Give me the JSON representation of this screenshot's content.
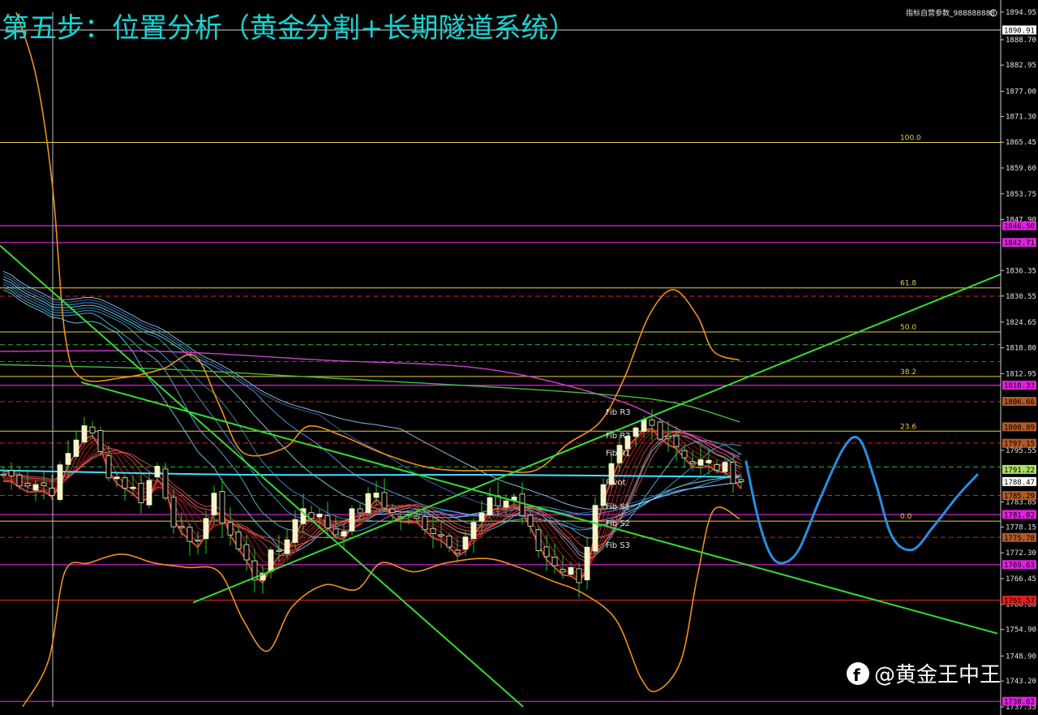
{
  "chart_data": {
    "type": "candlestick",
    "title": "第五步：位置分析（黄金分割+长期隧道系统）",
    "indicator_label": "指标自营参数_988888888",
    "watermark": "@黄金王中王",
    "ylim": [
      1737.35,
      1894.95
    ],
    "y_ticks": [
      "1894.95",
      "1888.70",
      "1882.95",
      "1877.00",
      "1871.30",
      "1865.45",
      "1859.60",
      "1853.75",
      "1847.90",
      "1836.35",
      "1830.55",
      "1824.65",
      "1818.80",
      "1812.95",
      "1795.55",
      "1783.85",
      "1778.15",
      "1772.30",
      "1766.45",
      "1760.60",
      "1754.90",
      "1748.90",
      "1743.20",
      "1737.35"
    ],
    "price_badges": [
      {
        "value": 1890.91,
        "text": "1890.91",
        "bg": "#ffffff",
        "fg": "#000000"
      },
      {
        "value": 1846.5,
        "text": "1846.50",
        "bg": "#e020e0",
        "fg": "#000000"
      },
      {
        "value": 1842.71,
        "text": "1842.71",
        "bg": "#e020e0",
        "fg": "#000000"
      },
      {
        "value": 1810.33,
        "text": "1810.33",
        "bg": "#e020e0",
        "fg": "#000000"
      },
      {
        "value": 1806.66,
        "text": "1806.66",
        "bg": "#b05a28",
        "fg": "#000000"
      },
      {
        "value": 1800.89,
        "text": "1800.89",
        "bg": "#b05a28",
        "fg": "#000000"
      },
      {
        "value": 1797.15,
        "text": "1797.15",
        "bg": "#b05a28",
        "fg": "#000000"
      },
      {
        "value": 1791.22,
        "text": "1791.22",
        "bg": "#a8e060",
        "fg": "#000000"
      },
      {
        "value": 1788.47,
        "text": "1788.47",
        "bg": "#ffffff",
        "fg": "#000000"
      },
      {
        "value": 1785.29,
        "text": "1785.29",
        "bg": "#b05a28",
        "fg": "#000000"
      },
      {
        "value": 1781.02,
        "text": "1781.02",
        "bg": "#e020e0",
        "fg": "#000000"
      },
      {
        "value": 1775.78,
        "text": "1775.78",
        "bg": "#b05a28",
        "fg": "#000000"
      },
      {
        "value": 1769.63,
        "text": "1769.63",
        "bg": "#e020e0",
        "fg": "#000000"
      },
      {
        "value": 1761.57,
        "text": "1761.57",
        "bg": "#e02020",
        "fg": "#000000"
      },
      {
        "value": 1738.62,
        "text": "1738.62",
        "bg": "#e020e0",
        "fg": "#000000"
      }
    ],
    "fib_levels": [
      {
        "label": "100.0",
        "value": 1865.4
      },
      {
        "label": "61.8",
        "value": 1832.4
      },
      {
        "label": "50.0",
        "value": 1822.4
      },
      {
        "label": "38.2",
        "value": 1812.3
      },
      {
        "label": "23.6",
        "value": 1799.9
      },
      {
        "label": "0.0",
        "value": 1779.5
      }
    ],
    "pivot_labels": [
      {
        "label": "Fib R3",
        "value": 1804.4
      },
      {
        "label": "Fib R2",
        "value": 1799.0
      },
      {
        "label": "Fib R1",
        "value": 1795.1
      },
      {
        "label": "Pivot",
        "value": 1788.4
      },
      {
        "label": "Fib S1",
        "value": 1782.9
      },
      {
        "label": "Fib S2",
        "value": 1779.1
      },
      {
        "label": "Fib S3",
        "value": 1774.2
      }
    ],
    "magenta_lines": [
      1846.5,
      1842.7,
      1810.3,
      1781.0,
      1769.6,
      1738.6
    ],
    "red_dashed_lines": [
      1830.5,
      1815.7,
      1806.6,
      1797.2,
      1785.3,
      1775.8
    ],
    "green_dashed_lines": [
      1819.5,
      1791.8
    ],
    "colors": {
      "title": "#17d4d4",
      "bull": "#f4f4c8",
      "bear": "#f4f4c8",
      "wick": "#22cc22",
      "bollinger": "#f09020",
      "trend": "#33dd33",
      "projection": "#2a8ee0",
      "fib": "#e8d040",
      "magenta": "#e020e0",
      "red": "#dd2020"
    }
  }
}
